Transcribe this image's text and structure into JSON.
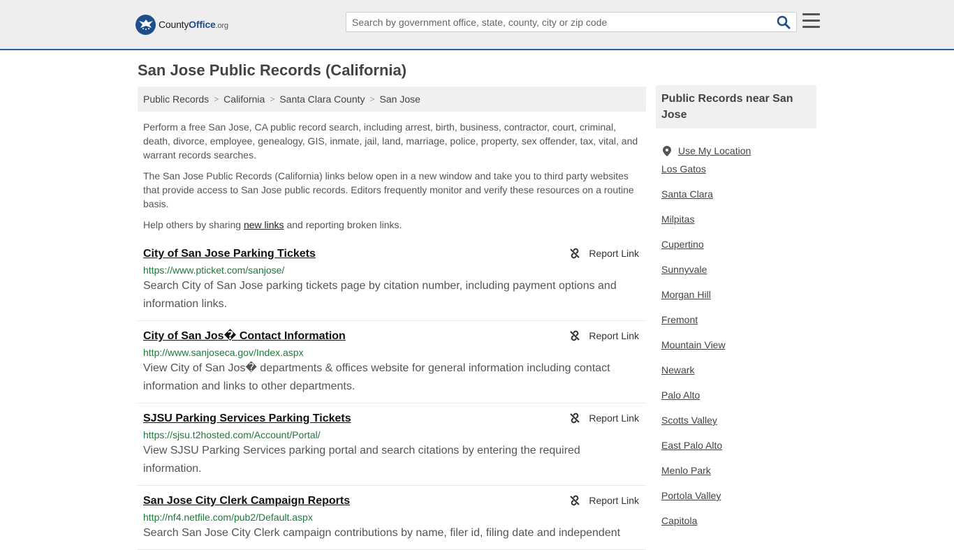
{
  "header": {
    "logo": {
      "name": "County",
      "bold": "Office",
      "suffix": ".org"
    },
    "search_placeholder": "Search by government office, state, county, city or zip code"
  },
  "page_title": "San Jose Public Records (California)",
  "breadcrumb": [
    "Public Records",
    "California",
    "Santa Clara County",
    "San Jose"
  ],
  "intro": {
    "p1": "Perform a free San Jose, CA public record search, including arrest, birth, business, contractor, court, criminal, death, divorce, employee, genealogy, GIS, inmate, jail, land, marriage, police, property, sex offender, tax, vital, and warrant records searches.",
    "p2": "The San Jose Public Records (California) links below open in a new window and take you to third party websites that provide access to San Jose public records. Editors frequently monitor and verify these resources on a routine basis.",
    "p3_before": "Help others by sharing ",
    "p3_link": "new links",
    "p3_after": " and reporting broken links."
  },
  "report_label": "Report Link",
  "results": [
    {
      "title": "City of San Jose Parking Tickets",
      "url": "https://www.pticket.com/sanjose/",
      "desc": "Search City of San Jose parking tickets page by citation number, including payment options and information links."
    },
    {
      "title": "City of San Jos� Contact Information",
      "url": "http://www.sanjoseca.gov/Index.aspx",
      "desc": "View City of San Jos� departments & offices website for general information including contact information and links to other departments."
    },
    {
      "title": "SJSU Parking Services Parking Tickets",
      "url": "https://sjsu.t2hosted.com/Account/Portal/",
      "desc": "View SJSU Parking Services parking portal and search citations by entering the required information."
    },
    {
      "title": "San Jose City Clerk Campaign Reports",
      "url": "http://nf4.netfile.com/pub2/Default.aspx",
      "desc": "Search San Jose City Clerk campaign contributions by name, filer id, filing date and independent"
    }
  ],
  "sidebar": {
    "title": "Public Records near San Jose",
    "use_location": "Use My Location",
    "places": [
      "Los Gatos",
      "Santa Clara",
      "Milpitas",
      "Cupertino",
      "Sunnyvale",
      "Morgan Hill",
      "Fremont",
      "Mountain View",
      "Newark",
      "Palo Alto",
      "Scotts Valley",
      "East Palo Alto",
      "Menlo Park",
      "Portola Valley",
      "Capitola"
    ]
  },
  "colors": {
    "accent": "#2d5f9e",
    "url_green": "#1c7a3a"
  }
}
